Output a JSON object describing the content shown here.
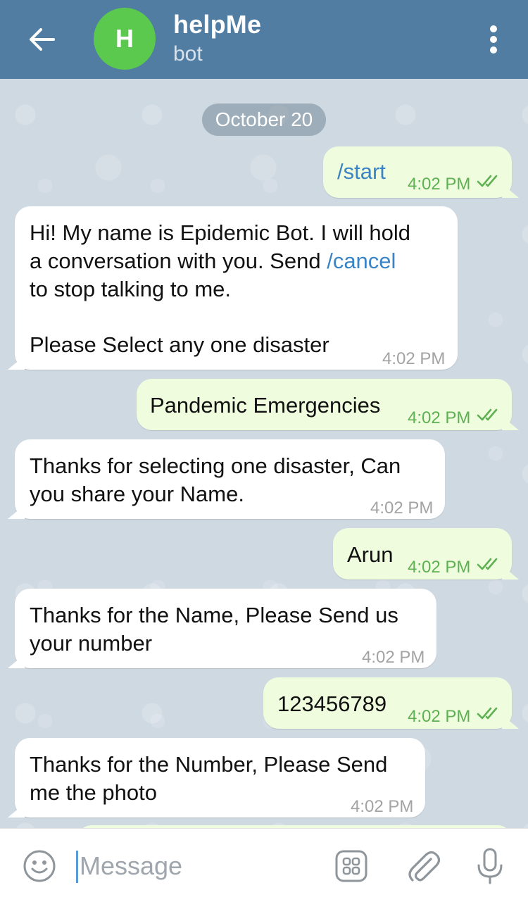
{
  "header": {
    "avatar_letter": "H",
    "title": "helpMe",
    "subtitle": "bot"
  },
  "chat": {
    "date": "October 20",
    "messages": [
      {
        "dir": "out",
        "text": "/start",
        "time": "4:02 PM"
      },
      {
        "dir": "in",
        "line1": "Hi! My name is Epidemic Bot. I will hold",
        "line2a": "a conversation with you. Send ",
        "cmd": "/cancel",
        "line3": "to stop talking to me.",
        "line4": "Please Select any one disaster",
        "time": "4:02 PM"
      },
      {
        "dir": "out",
        "text": "Pandemic Emergencies",
        "time": "4:02 PM"
      },
      {
        "dir": "in",
        "line1": "Thanks for selecting one disaster, Can",
        "line2": "you share your Name.",
        "time": "4:02 PM"
      },
      {
        "dir": "out",
        "text": "Arun",
        "time": "4:02 PM"
      },
      {
        "dir": "in",
        "line1": "Thanks for the Name, Please Send us",
        "line2": "your number",
        "time": "4:02 PM"
      },
      {
        "dir": "out",
        "text": "123456789",
        "time": "4:02 PM"
      },
      {
        "dir": "in",
        "line1": "Thanks for the Number, Please Send",
        "line2": "me the photo",
        "time": "4:02 PM"
      }
    ]
  },
  "composer": {
    "placeholder": "Message"
  },
  "icons": {
    "back": "arrow-left-icon",
    "menu": "more-vertical-icon",
    "emoji": "smile-icon",
    "bot_commands": "bot-keyboard-icon",
    "attach": "paperclip-icon",
    "mic": "microphone-icon",
    "read": "double-check-icon"
  },
  "colors": {
    "header": "#517da2",
    "avatar": "#5bc84e",
    "outgoing_bubble": "#effdde",
    "incoming_bubble": "#ffffff",
    "outgoing_time": "#5fb053",
    "command_link": "#3a83c5"
  }
}
